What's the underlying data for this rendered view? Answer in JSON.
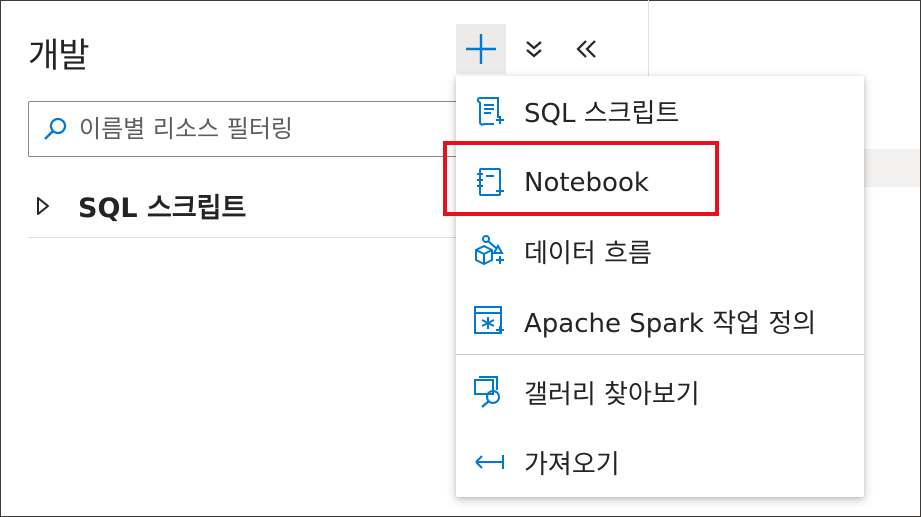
{
  "panel": {
    "title": "개발",
    "toolbar": {
      "add_icon": "plus-icon",
      "expand_icon": "expand-all-icon",
      "collapse_icon": "collapse-panel-icon"
    },
    "search": {
      "placeholder": "이름별 리소스 필터링",
      "icon": "search-icon"
    },
    "tree": [
      {
        "label": "SQL 스크립트",
        "icon": "caret-right-icon"
      }
    ]
  },
  "menu": {
    "items": [
      {
        "label": "SQL 스크립트",
        "icon": "sql-script-icon"
      },
      {
        "label": "Notebook",
        "icon": "notebook-icon"
      },
      {
        "label": "데이터 흐름",
        "icon": "data-flow-icon"
      },
      {
        "label": "Apache Spark 작업 정의",
        "icon": "spark-job-icon"
      },
      {
        "label": "갤러리 찾아보기",
        "icon": "gallery-icon"
      },
      {
        "label": "가져오기",
        "icon": "import-icon"
      }
    ]
  },
  "colors": {
    "accent": "#0078d4",
    "highlight": "#e3121b",
    "text": "#252423"
  }
}
